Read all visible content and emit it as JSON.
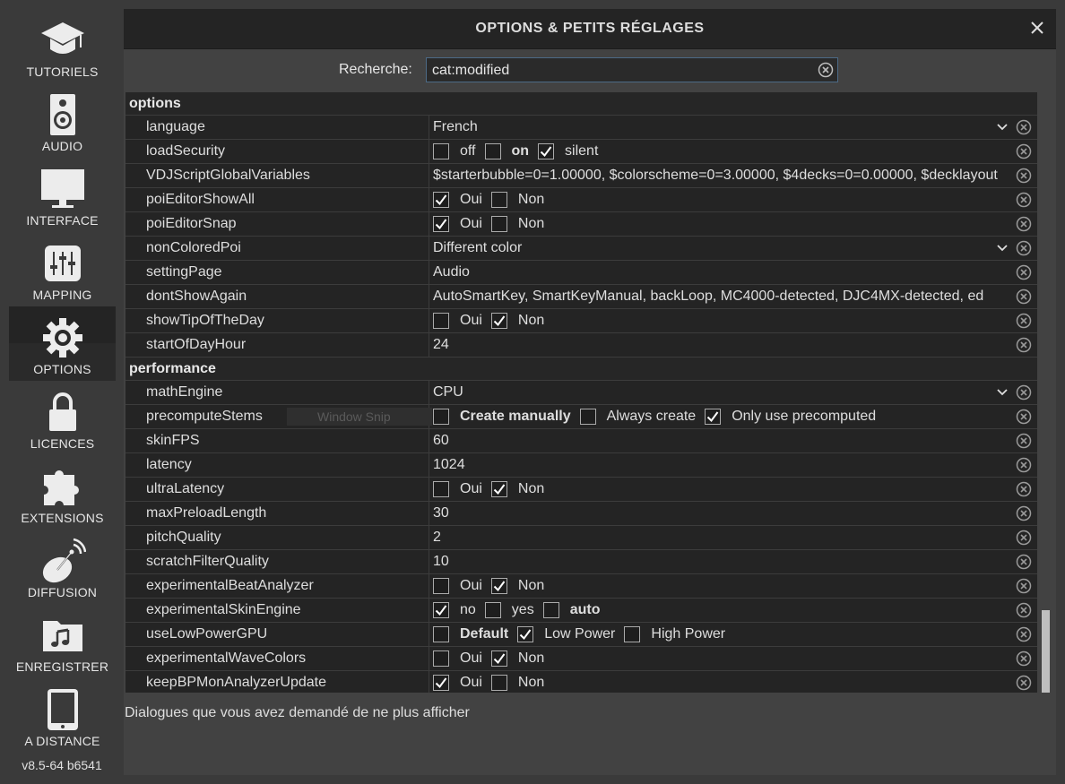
{
  "sidebar": {
    "items": [
      {
        "id": "tutoriels",
        "label": "TUTORIELS",
        "icon": "graduation-cap-icon",
        "active": false
      },
      {
        "id": "audio",
        "label": "AUDIO",
        "icon": "speaker-icon",
        "active": false
      },
      {
        "id": "interface",
        "label": "INTERFACE",
        "icon": "monitor-icon",
        "active": false
      },
      {
        "id": "mapping",
        "label": "MAPPING",
        "icon": "sliders-icon",
        "active": false
      },
      {
        "id": "options",
        "label": "OPTIONS",
        "icon": "gear-icon",
        "active": true
      },
      {
        "id": "licences",
        "label": "LICENCES",
        "icon": "lock-icon",
        "active": false
      },
      {
        "id": "extensions",
        "label": "EXTENSIONS",
        "icon": "puzzle-icon",
        "active": false
      },
      {
        "id": "diffusion",
        "label": "DIFFUSION",
        "icon": "satellite-dish-icon",
        "active": false
      },
      {
        "id": "enregistrer",
        "label": "ENREGISTRER",
        "icon": "music-folder-icon",
        "active": false
      },
      {
        "id": "a-distance",
        "label": "A DISTANCE",
        "icon": "tablet-icon",
        "active": false
      }
    ],
    "version": "v8.5-64 b6541"
  },
  "dialog": {
    "title": "OPTIONS & PETITS RÉGLAGES",
    "close_icon": "close-icon"
  },
  "search": {
    "label": "Recherche:",
    "value": "cat:modified"
  },
  "ghost_overlay": "Window Snip",
  "sections": [
    {
      "name": "options",
      "rows": [
        {
          "name": "language",
          "type": "dropdown",
          "value": "French"
        },
        {
          "name": "loadSecurity",
          "type": "checks",
          "options": [
            {
              "label": "off",
              "checked": false,
              "bold": false
            },
            {
              "label": "on",
              "checked": false,
              "bold": true
            },
            {
              "label": "silent",
              "checked": true,
              "bold": false
            }
          ]
        },
        {
          "name": "VDJScriptGlobalVariables",
          "type": "text",
          "value": "$starterbubble=0=1.00000, $colorscheme=0=3.00000, $4decks=0=0.00000, $decklayout"
        },
        {
          "name": "poiEditorShowAll",
          "type": "checks",
          "options": [
            {
              "label": "Oui",
              "checked": true,
              "bold": false
            },
            {
              "label": "Non",
              "checked": false,
              "bold": false
            }
          ]
        },
        {
          "name": "poiEditorSnap",
          "type": "checks",
          "options": [
            {
              "label": "Oui",
              "checked": true,
              "bold": false
            },
            {
              "label": "Non",
              "checked": false,
              "bold": false
            }
          ]
        },
        {
          "name": "nonColoredPoi",
          "type": "dropdown",
          "value": "Different color"
        },
        {
          "name": "settingPage",
          "type": "text",
          "value": "Audio"
        },
        {
          "name": "dontShowAgain",
          "type": "text",
          "value": "AutoSmartKey, SmartKeyManual, backLoop, MC4000-detected, DJC4MX-detected, ed"
        },
        {
          "name": "showTipOfTheDay",
          "type": "checks",
          "options": [
            {
              "label": "Oui",
              "checked": false,
              "bold": false
            },
            {
              "label": "Non",
              "checked": true,
              "bold": false
            }
          ]
        },
        {
          "name": "startOfDayHour",
          "type": "text",
          "value": "24"
        }
      ]
    },
    {
      "name": "performance",
      "rows": [
        {
          "name": "mathEngine",
          "type": "dropdown",
          "value": "CPU"
        },
        {
          "name": "precomputeStems",
          "type": "checks",
          "options": [
            {
              "label": "Create manually",
              "checked": false,
              "bold": true
            },
            {
              "label": "Always create",
              "checked": false,
              "bold": false
            },
            {
              "label": "Only use precomputed",
              "checked": true,
              "bold": false
            }
          ]
        },
        {
          "name": "skinFPS",
          "type": "text",
          "value": "60"
        },
        {
          "name": "latency",
          "type": "text",
          "value": "1024"
        },
        {
          "name": "ultraLatency",
          "type": "checks",
          "options": [
            {
              "label": "Oui",
              "checked": false,
              "bold": false
            },
            {
              "label": "Non",
              "checked": true,
              "bold": false
            }
          ]
        },
        {
          "name": "maxPreloadLength",
          "type": "text",
          "value": "30"
        },
        {
          "name": "pitchQuality",
          "type": "text",
          "value": "2"
        },
        {
          "name": "scratchFilterQuality",
          "type": "text",
          "value": "10"
        },
        {
          "name": "experimentalBeatAnalyzer",
          "type": "checks",
          "options": [
            {
              "label": "Oui",
              "checked": false,
              "bold": false
            },
            {
              "label": "Non",
              "checked": true,
              "bold": false
            }
          ]
        },
        {
          "name": "experimentalSkinEngine",
          "type": "checks",
          "options": [
            {
              "label": "no",
              "checked": true,
              "bold": false
            },
            {
              "label": "yes",
              "checked": false,
              "bold": false
            },
            {
              "label": "auto",
              "checked": false,
              "bold": true
            }
          ]
        },
        {
          "name": "useLowPowerGPU",
          "type": "checks",
          "options": [
            {
              "label": "Default",
              "checked": false,
              "bold": true
            },
            {
              "label": "Low Power",
              "checked": true,
              "bold": false
            },
            {
              "label": "High Power",
              "checked": false,
              "bold": false
            }
          ]
        },
        {
          "name": "experimentalWaveColors",
          "type": "checks",
          "options": [
            {
              "label": "Oui",
              "checked": false,
              "bold": false
            },
            {
              "label": "Non",
              "checked": true,
              "bold": false
            }
          ]
        },
        {
          "name": "keepBPMonAnalyzerUpdate",
          "type": "checks",
          "options": [
            {
              "label": "Oui",
              "checked": true,
              "bold": false
            },
            {
              "label": "Non",
              "checked": false,
              "bold": false
            }
          ]
        }
      ]
    }
  ],
  "footer": "Dialogues que vous avez demandé de ne plus afficher",
  "colors": {
    "background": "#3a3a3a",
    "panel": "#424242",
    "table": "#242424",
    "search_border": "#4c6a86",
    "text": "#dedede"
  }
}
